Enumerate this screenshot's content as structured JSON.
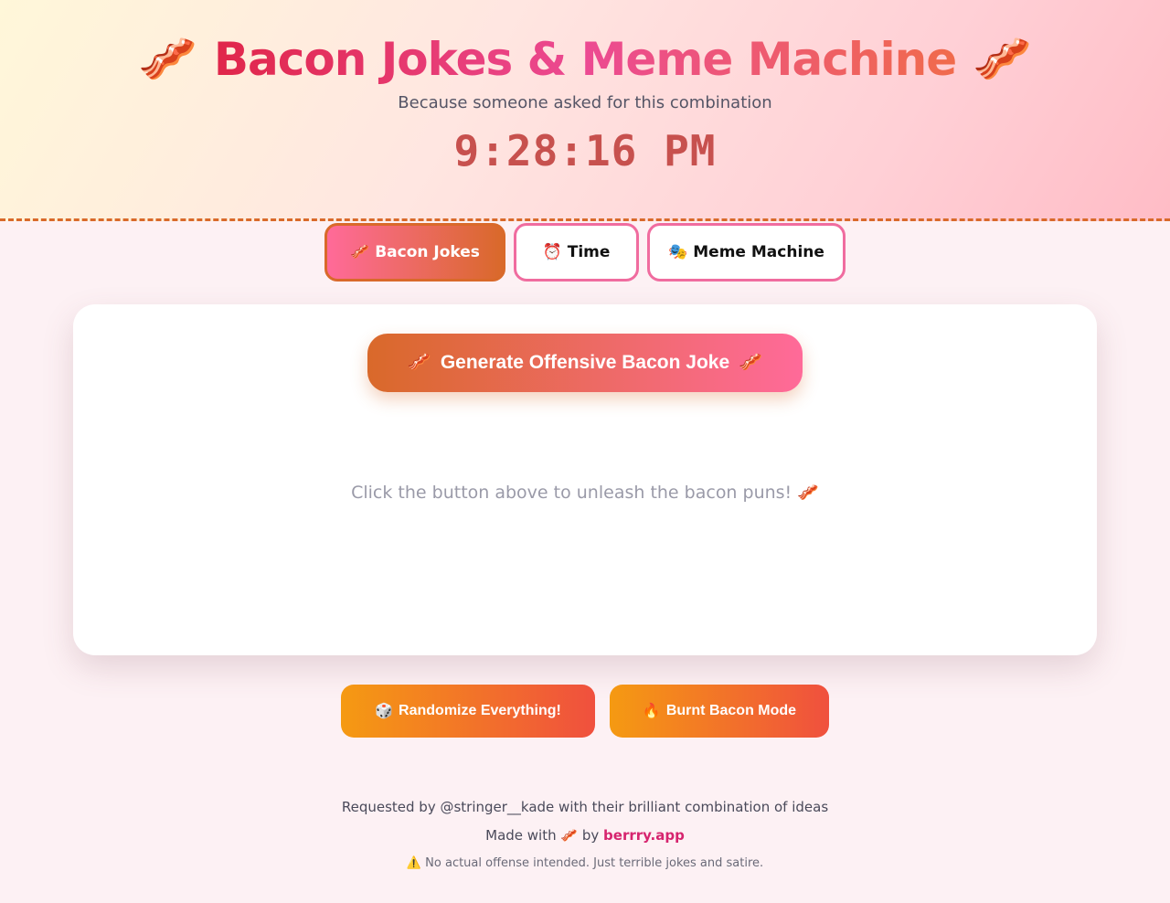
{
  "header": {
    "title": "Bacon Jokes & Meme Machine",
    "bacon_emoji": "🥓",
    "subtitle": "Because someone asked for this combination",
    "clock": "9:28:16 PM"
  },
  "tabs": [
    {
      "icon": "🥓",
      "label": "Bacon Jokes",
      "active": true
    },
    {
      "icon": "⏰",
      "label": "Time",
      "active": false
    },
    {
      "icon": "🎭",
      "label": "Meme Machine",
      "active": false
    }
  ],
  "card": {
    "generate_icon": "🥓",
    "generate_label": "Generate Offensive Bacon Joke",
    "placeholder": "Click the button above to unleash the bacon puns! 🥓"
  },
  "actions": [
    {
      "icon": "🎲",
      "label": "Randomize Everything!"
    },
    {
      "icon": "🔥",
      "label": "Burnt Bacon Mode"
    }
  ],
  "footer": {
    "requested": "Requested by @stringer__kade with their brilliant combination of ideas",
    "made_with_prefix": "Made with",
    "made_with_icon": "🥓",
    "made_with_by": "by",
    "brand": "berrry.app",
    "disclaimer": "⚠️ No actual offense intended. Just terrible jokes and satire."
  },
  "colors": {
    "accent_pink": "#ff6a99",
    "accent_orange": "#d9692a",
    "brand": "#d6246e",
    "clock": "#c7514e"
  }
}
